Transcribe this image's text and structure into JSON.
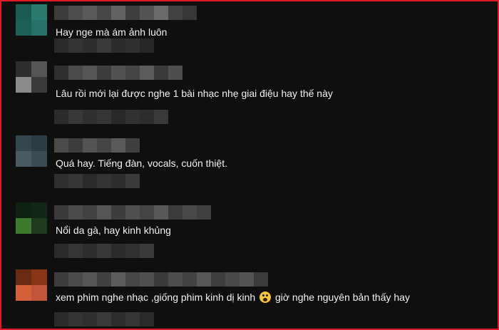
{
  "comments": [
    {
      "text": "Hay nge mà ám ảnh luôn",
      "avatar_colors": [
        "#1c5b52",
        "#2a7a6d",
        "#1d5f55",
        "#27716a"
      ],
      "emoji": ""
    },
    {
      "text": "Lâu rồi mới lại được nghe 1 bài nhạc nhẹ giai điệu hay thế này",
      "avatar_colors": [
        "#2e2e2e",
        "#555555",
        "#8a8a8a",
        "#3a3a3a"
      ],
      "emoji": ""
    },
    {
      "text": "Quá hay. Tiếng đàn, vocals, cuốn thiệt.",
      "avatar_colors": [
        "#34474f",
        "#2c3c44",
        "#4a5a62",
        "#3b4b53"
      ],
      "emoji": ""
    },
    {
      "text": "Nổi da gà, hay kinh khủng",
      "avatar_colors": [
        "#0f2212",
        "#132616",
        "#3e7a2e",
        "#1f3a1f"
      ],
      "emoji": ""
    },
    {
      "text_before": "xem phim nghe nhạc ,giống phim kinh dị kinh ",
      "text_after": " giờ nghe nguyên bản thấy hay",
      "avatar_colors": [
        "#6a2a14",
        "#8a3518",
        "#d4603a",
        "#c2553a"
      ],
      "emoji": "fearful-face"
    }
  ],
  "colors": {
    "background": "#0f0f0f",
    "text": "#f1f1f1",
    "border": "#e01b24"
  }
}
